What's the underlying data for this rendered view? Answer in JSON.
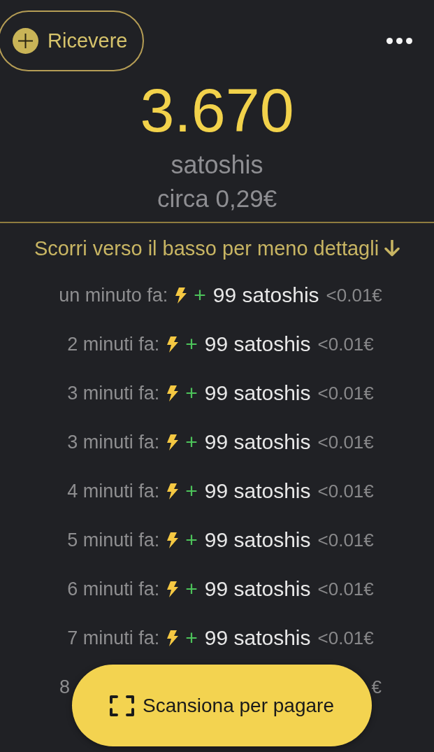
{
  "header": {
    "receive_button": {
      "label": "Ricevere"
    }
  },
  "balance": {
    "amount": "3.670",
    "unit": "satoshis",
    "fiat": "circa 0,29€"
  },
  "scroll_hint": "Scorri verso il basso per meno dettagli",
  "transactions": [
    {
      "time": "un minuto fa:",
      "sign": "+",
      "amount": "99 satoshis",
      "fiat": "<0.01€"
    },
    {
      "time": "2 minuti fa:",
      "sign": "+",
      "amount": "99 satoshis",
      "fiat": "<0.01€"
    },
    {
      "time": "3 minuti fa:",
      "sign": "+",
      "amount": "99 satoshis",
      "fiat": "<0.01€"
    },
    {
      "time": "3 minuti fa:",
      "sign": "+",
      "amount": "99 satoshis",
      "fiat": "<0.01€"
    },
    {
      "time": "4 minuti fa:",
      "sign": "+",
      "amount": "99 satoshis",
      "fiat": "<0.01€"
    },
    {
      "time": "5 minuti fa:",
      "sign": "+",
      "amount": "99 satoshis",
      "fiat": "<0.01€"
    },
    {
      "time": "6 minuti fa:",
      "sign": "+",
      "amount": "99 satoshis",
      "fiat": "<0.01€"
    },
    {
      "time": "7 minuti fa:",
      "sign": "+",
      "amount": "99 satoshis",
      "fiat": "<0.01€"
    },
    {
      "time": "8",
      "fiat": "€"
    }
  ],
  "scan_button": {
    "label": "Scansiona per pagare"
  }
}
